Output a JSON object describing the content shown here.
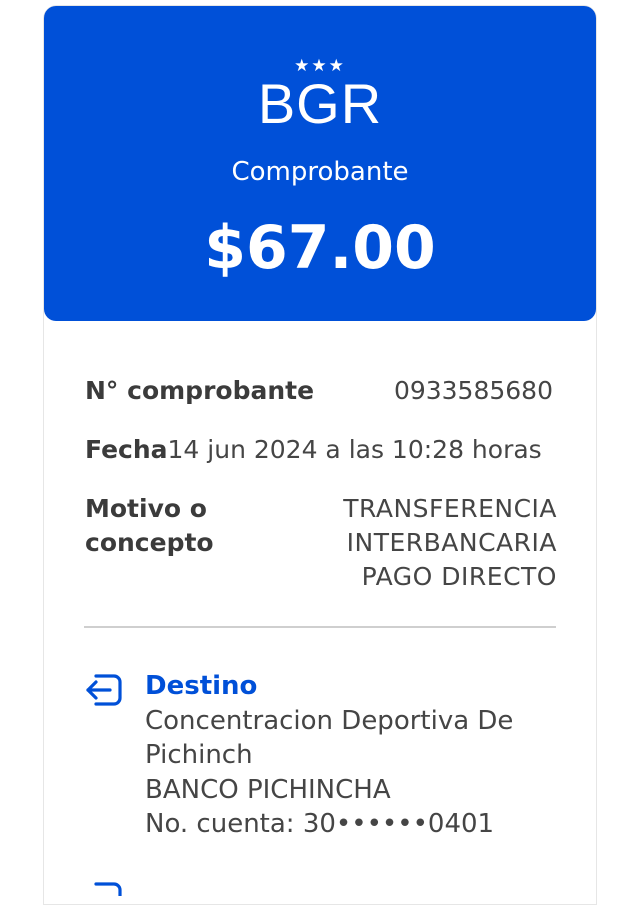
{
  "header": {
    "stars": "★★★",
    "brand": "BGR",
    "subtitle": "Comprobante",
    "amount": "$67.00",
    "bg_color": "#0050d8"
  },
  "details": {
    "receipt_label": "N° comprobante",
    "receipt_value": "0933585680",
    "date_label": "Fecha",
    "date_value": "14 jun 2024 a las 10:28 horas",
    "reason_label_line1": "Motivo o",
    "reason_label_line2": "concepto",
    "reason_value_line1": "TRANSFERENCIA",
    "reason_value_line2": "INTERBANCARIA",
    "reason_value_line3": "PAGO DIRECTO"
  },
  "destination": {
    "icon": "login-arrow-icon",
    "title": "Destino",
    "name_line1": "Concentracion Deportiva De",
    "name_line2": "Pichinch",
    "bank": "BANCO PICHINCHA",
    "account": "No. cuenta: 30••••••0401"
  },
  "colors": {
    "accent": "#0050d8",
    "text": "#3c3c3c",
    "divider": "#cfcfcf"
  }
}
